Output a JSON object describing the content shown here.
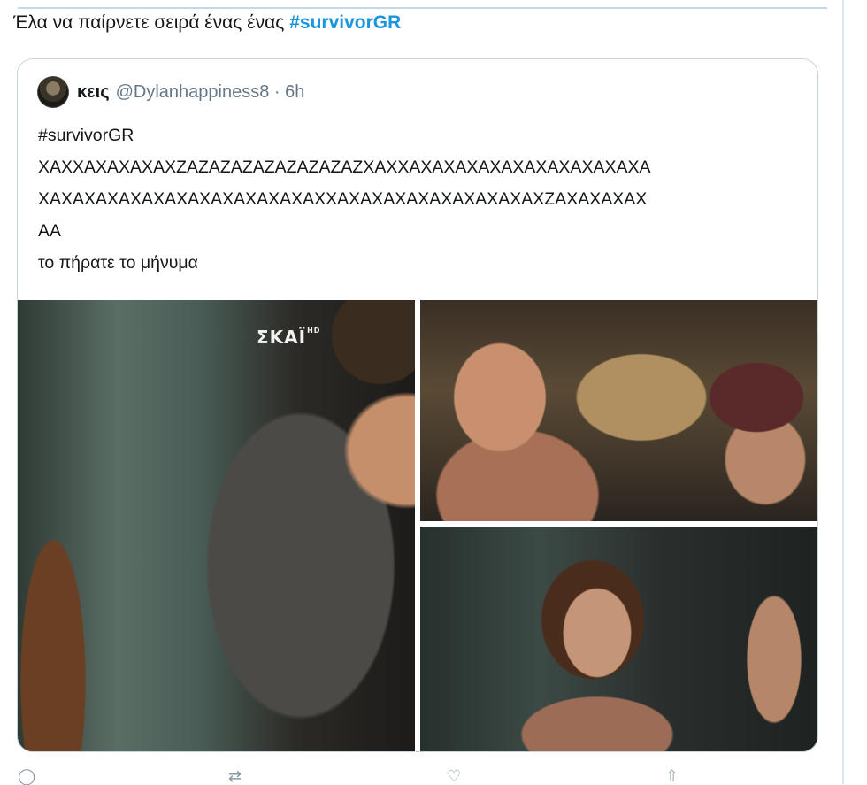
{
  "tweet": {
    "text": "Έλα να παίρνετε σειρά ένας ένας ",
    "hashtag": "#survivorGR"
  },
  "quoted_tweet": {
    "name": "κεις",
    "handle": "@Dylanhappiness8 · 6h",
    "lines": [
      "#survivorGR",
      "XAXXAXAXAXAXZAZAZAZAZAZAZAZAZXAXXAXAXAXAXAXAXAXAXAXAXA",
      "XAXAXAXAXAXAXAXAXAXAXAXAXXAXAXAXAXAXAXAXAXAXZAXAXAXAX",
      "AA",
      "το πήρατε το μήνυμα"
    ],
    "media": [
      {
        "alt": "image-1",
        "watermark": "ΣΚΑΪ",
        "watermark_sup": "HD"
      },
      {
        "alt": "image-2"
      },
      {
        "alt": "image-3"
      }
    ]
  },
  "actions": {
    "icons": [
      "reply-icon",
      "retweet-icon",
      "like-icon",
      "share-icon"
    ]
  }
}
